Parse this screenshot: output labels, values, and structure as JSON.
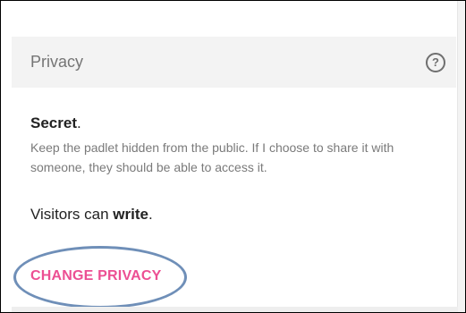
{
  "privacy_panel": {
    "title": "Privacy",
    "help_icon": "help-circle-icon",
    "mode_label": "Secret",
    "mode_suffix": ".",
    "mode_description": "Keep the padlet hidden from the public. If I choose to share it with someone, they should be able to access it.",
    "visitors_prefix": "Visitors can ",
    "visitors_permission": "write",
    "visitors_suffix": ".",
    "change_button_label": "CHANGE PRIVACY"
  },
  "colors": {
    "accent": "#ec4f93",
    "header_bg": "#f3f3f3",
    "annotation_circle": "#6f8fb8"
  }
}
